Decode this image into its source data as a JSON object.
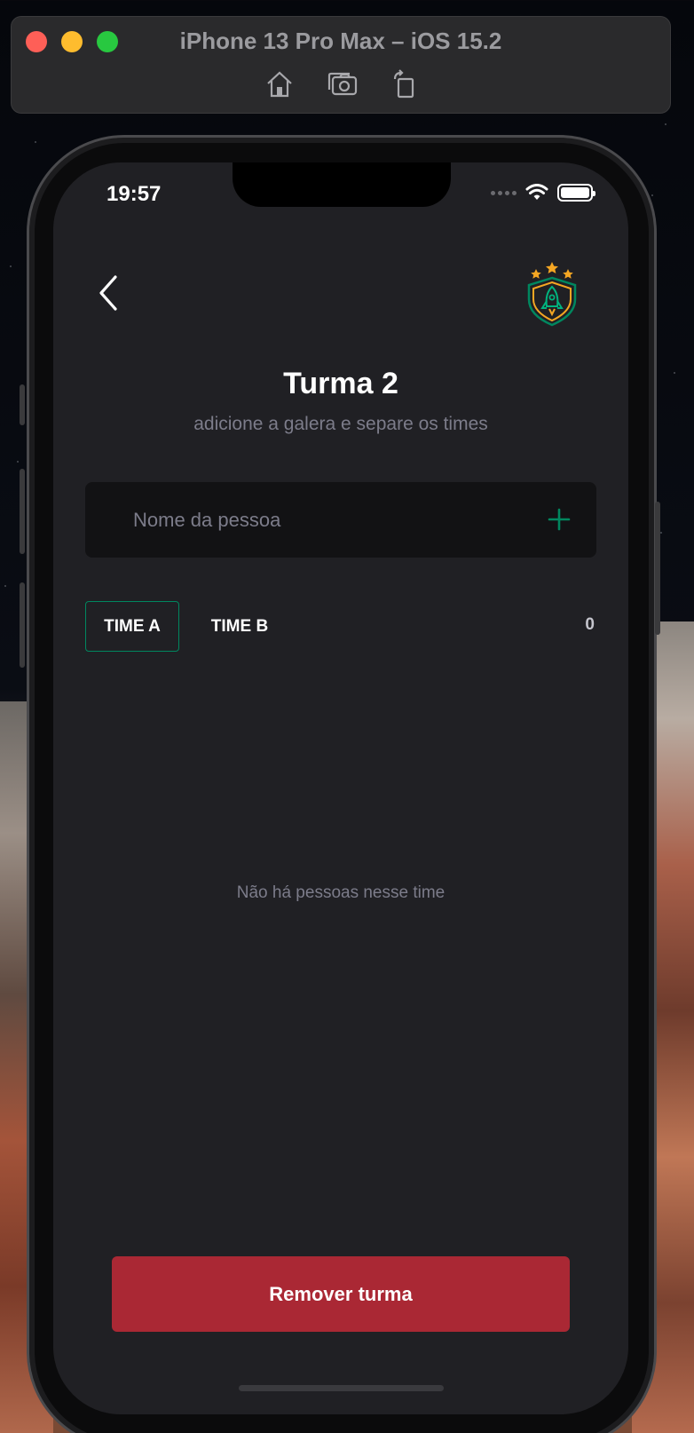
{
  "simulator": {
    "title": "iPhone 13 Pro Max – iOS 15.2",
    "tools": [
      "home-icon",
      "screenshot-icon",
      "rotate-icon"
    ]
  },
  "status_bar": {
    "time": "19:57",
    "icons": [
      "signal-icon",
      "wifi-icon",
      "battery-icon"
    ]
  },
  "header": {
    "back_icon": "chevron-left-icon",
    "logo_icon": "shield-rocket-logo-icon"
  },
  "group": {
    "title": "Turma 2",
    "subtitle": "adicione a galera e separe os times"
  },
  "person_input": {
    "value": "",
    "placeholder": "Nome da pessoa",
    "add_icon": "plus-icon"
  },
  "teams": {
    "tabs": [
      {
        "label": "TIME A",
        "active": true
      },
      {
        "label": "TIME B",
        "active": false
      }
    ],
    "count": "0"
  },
  "players": {
    "empty_message": "Não há pessoas nesse time"
  },
  "actions": {
    "remove_label": "Remover turma"
  },
  "colors": {
    "background": "#202024",
    "input_bg": "#121214",
    "accent_green": "#00875f",
    "danger_red": "#aa2834",
    "logo_gold": "#f5a623",
    "muted_text": "#7c7c8a"
  }
}
